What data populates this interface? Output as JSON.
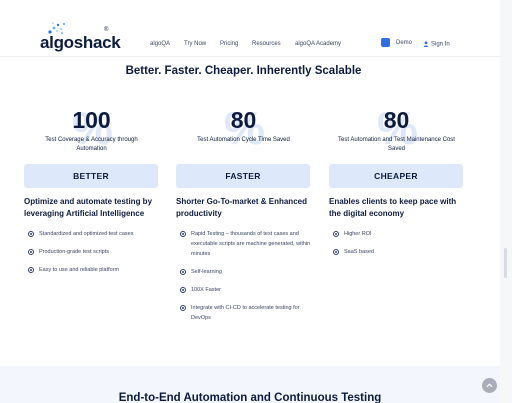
{
  "nav": {
    "logo_text": "algoshack",
    "logo_reg": "®",
    "menu": [
      "algoQA",
      "Try Now",
      "Pricing",
      "Resources",
      "algoQA Academy"
    ],
    "demo_label": "Demo",
    "signin_label": "Sign In"
  },
  "headline": "Better. Faster. Cheaper. Inherently Scalable",
  "columns": [
    {
      "stat": "100",
      "watermark": "%",
      "caption": "Test Coverage & Accuracy through Automation",
      "badge": "BETTER",
      "subhead": "Optimize and automate testing by leveraging Artificial Intelligence",
      "bullets": [
        "Standardized and optimized test cases",
        "Production-grade test scripts",
        "Easy to use and reliable platform"
      ]
    },
    {
      "stat": "80",
      "watermark": "%",
      "caption": "Test Automation Cycle Time Saved",
      "badge": "FASTER",
      "subhead": "Shorter Go-To-market & Enhanced productivity",
      "bullets": [
        "Rapid Testing – thousands of test cases and executable scripts are machine generated, within minutes",
        "Self-learning",
        "100X Faster",
        "Integrate with CI-CD to accelerate testing for DevOps"
      ]
    },
    {
      "stat": "80",
      "watermark": "%",
      "caption": "Test Automation and Test Maintenance Cost Saved",
      "badge": "CHEAPER",
      "subhead": "Enables clients to keep pace with the digital economy",
      "bullets": [
        "Higher ROI",
        "SaaS based"
      ]
    }
  ],
  "bottom_title": "End-to-End Automation and Continuous Testing",
  "colors": {
    "navy": "#0d1b3e",
    "badge_bg": "#dde8fb",
    "accent_blue": "#2f6fe4",
    "watermark": "#dfe8f8"
  }
}
